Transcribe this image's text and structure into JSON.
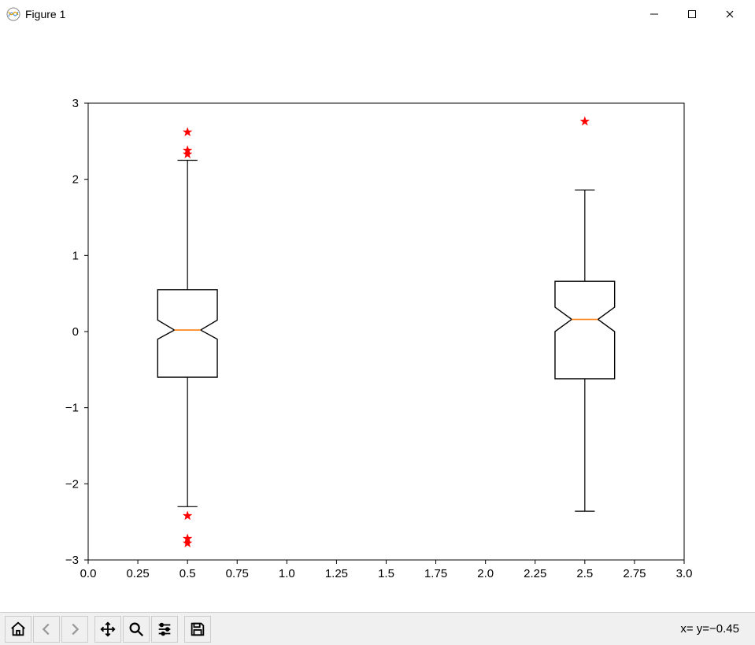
{
  "window": {
    "title": "Figure 1"
  },
  "status": {
    "coords": "x= y=−0.45"
  },
  "chart_data": {
    "type": "boxplot",
    "xlim": [
      0.0,
      3.0
    ],
    "ylim": [
      -3,
      3
    ],
    "xticks": [
      0.0,
      0.25,
      0.5,
      0.75,
      1.0,
      1.25,
      1.5,
      1.75,
      2.0,
      2.25,
      2.5,
      2.75,
      3.0
    ],
    "xtick_labels": [
      "0.0",
      "0.25",
      "0.5",
      "0.75",
      "1.0",
      "1.25",
      "1.5",
      "1.75",
      "2.0",
      "2.25",
      "2.5",
      "2.75",
      "3.0"
    ],
    "yticks": [
      -3,
      -2,
      -1,
      0,
      1,
      2,
      3
    ],
    "ytick_labels": [
      "−3",
      "−2",
      "−1",
      "0",
      "1",
      "2",
      "3"
    ],
    "notched": true,
    "series": [
      {
        "position": 0.5,
        "q1": -0.6,
        "median": 0.02,
        "q3": 0.55,
        "whisker_low": -2.3,
        "whisker_high": 2.25,
        "notch_lower": -0.1,
        "notch_upper": 0.15,
        "fliers": [
          2.62,
          2.38,
          2.33,
          -2.42,
          -2.72,
          -2.78
        ]
      },
      {
        "position": 2.5,
        "q1": -0.62,
        "median": 0.16,
        "q3": 0.66,
        "whisker_low": -2.36,
        "whisker_high": 1.86,
        "notch_lower": 0.0,
        "notch_upper": 0.32,
        "fliers": [
          2.76
        ]
      }
    ]
  }
}
